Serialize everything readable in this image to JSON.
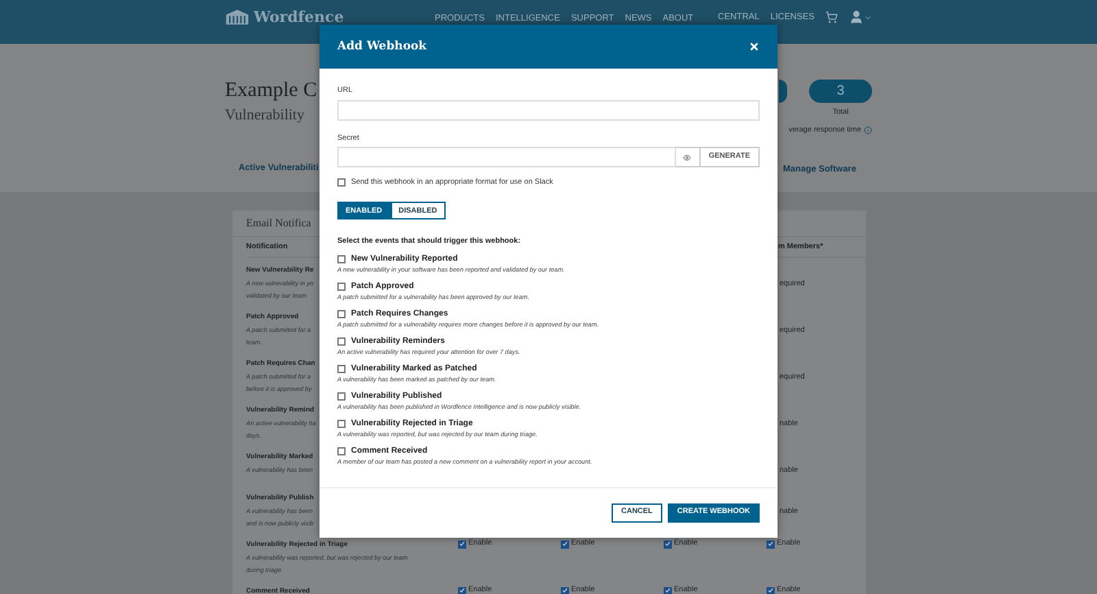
{
  "header": {
    "logo": "Wordfence",
    "nav": [
      "PRODUCTS",
      "INTELLIGENCE",
      "SUPPORT",
      "NEWS",
      "ABOUT"
    ],
    "account_nav": [
      "CENTRAL",
      "LICENSES"
    ]
  },
  "page": {
    "title": "Example C",
    "subtitle": "Vulnerability",
    "stat": {
      "value": "3",
      "label": "Total"
    },
    "response_note": "verage response time",
    "links": [
      "Active Vulnerabiliti",
      "Manage Software"
    ]
  },
  "notifications_card": {
    "title": "Email Notifica",
    "columns": [
      "Notification",
      "m Members*"
    ],
    "rows": [
      {
        "kind": "covered",
        "title": "New Vulnerability Re",
        "description_lines": [
          "A new vulnerability in yo",
          "validated by our team."
        ],
        "last_cell": "equired"
      },
      {
        "kind": "covered",
        "title": "Patch Approved",
        "description_lines": [
          "A patch submitted for a",
          "team."
        ],
        "last_cell": "equired"
      },
      {
        "kind": "covered",
        "title": "Patch Requires Chan",
        "description_lines": [
          "A patch submitted for a",
          "before it is approved by"
        ],
        "last_cell": "equired"
      },
      {
        "kind": "covered",
        "title": "Vulnerability Remind",
        "description_lines": [
          "An active vulnerability ha",
          "days."
        ],
        "last_cell": "nable"
      },
      {
        "kind": "covered",
        "title": "Vulnerability Marked",
        "description_lines": [
          "A vulnerability has been"
        ],
        "last_cell": "nable"
      },
      {
        "kind": "covered",
        "title": "Vulnerability Publish",
        "description_lines": [
          "A vulnerability has been",
          "and is now publicly visib"
        ],
        "last_cell": "nable"
      },
      {
        "kind": "full",
        "title": "Vulnerability Rejected in Triage",
        "description_lines": [
          "A vulnerability was reported, but was rejected by our team",
          "during triage."
        ],
        "cells": [
          {
            "label": "Enable",
            "checked": true
          },
          {
            "label": "Enable",
            "checked": true
          },
          {
            "label": "Enable",
            "checked": true
          },
          {
            "label": "Enable",
            "checked": true
          }
        ]
      },
      {
        "kind": "full",
        "title": "Comment Received",
        "cells": [
          {
            "label": "Enable",
            "checked": true
          },
          {
            "label": "Enable",
            "checked": true
          },
          {
            "label": "Enable",
            "checked": true
          },
          {
            "label": "Enable",
            "checked": true
          }
        ]
      }
    ]
  },
  "modal": {
    "title": "Add Webhook",
    "url_label": "URL",
    "secret_label": "Secret",
    "generate_button": "GENERATE",
    "slack_option": {
      "label": "Send this webhook in an appropriate format for use on Slack",
      "checked": false
    },
    "status_toggle": [
      {
        "label": "ENABLED",
        "selected": true
      },
      {
        "label": "DISABLED",
        "selected": false
      }
    ],
    "events_heading": "Select the events that should trigger this webhook:",
    "events": [
      {
        "title": "New Vulnerability Reported",
        "description": "A new vulnerability in your software has been reported and validated by our team.",
        "checked": false
      },
      {
        "title": "Patch Approved",
        "description": "A patch submitted for a vulnerability has been approved by our team.",
        "checked": false
      },
      {
        "title": "Patch Requires Changes",
        "description": "A patch submitted for a vulnerability requires more changes before it is approved by our team.",
        "checked": false
      },
      {
        "title": "Vulnerability Reminders",
        "description": "An active vulnerability has required your attention for over 7 days.",
        "checked": false
      },
      {
        "title": "Vulnerability Marked as Patched",
        "description": "A vulnerability has been marked as patched by our team.",
        "checked": false
      },
      {
        "title": "Vulnerability Published",
        "description": "A vulnerability has been published in Wordfence Intelligence and is now publicly visible.",
        "checked": false
      },
      {
        "title": "Vulnerability Rejected in Triage",
        "description": "A vulnerability was reported, but was rejected by our team during triage.",
        "checked": false
      },
      {
        "title": "Comment Received",
        "description": "A member of our team has posted a new comment on a vulnerability report in your account.",
        "checked": false
      }
    ],
    "buttons": [
      {
        "label": "CANCEL",
        "kind": "secondary"
      },
      {
        "label": "CREATE WEBHOOK",
        "kind": "primary"
      }
    ]
  }
}
